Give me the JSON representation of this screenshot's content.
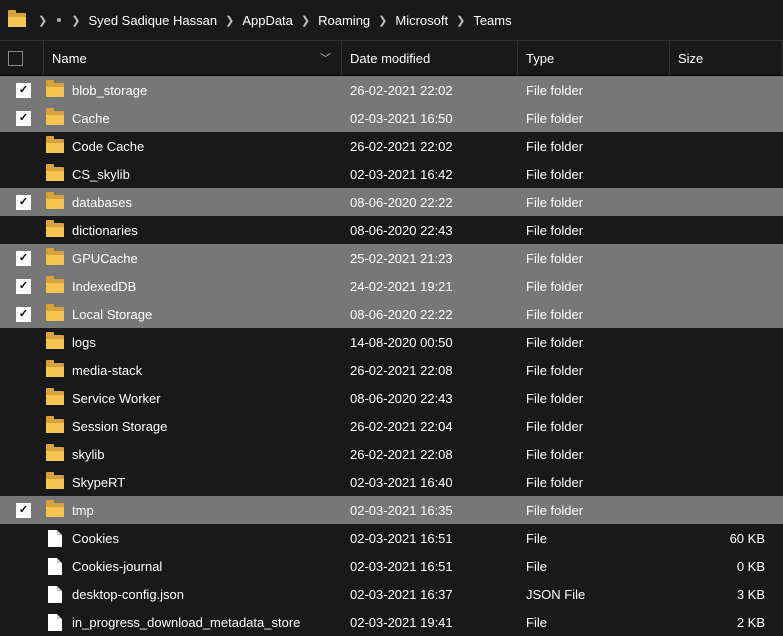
{
  "breadcrumb": {
    "items": [
      "Syed Sadique Hassan",
      "AppData",
      "Roaming",
      "Microsoft",
      "Teams"
    ]
  },
  "columns": {
    "name": "Name",
    "date": "Date modified",
    "type": "Type",
    "size": "Size"
  },
  "rows": [
    {
      "selected": true,
      "kind": "folder",
      "name": "blob_storage",
      "date": "26-02-2021 22:02",
      "type": "File folder",
      "size": ""
    },
    {
      "selected": true,
      "kind": "folder",
      "name": "Cache",
      "date": "02-03-2021 16:50",
      "type": "File folder",
      "size": ""
    },
    {
      "selected": false,
      "kind": "folder",
      "name": "Code Cache",
      "date": "26-02-2021 22:02",
      "type": "File folder",
      "size": ""
    },
    {
      "selected": false,
      "kind": "folder",
      "name": "CS_skylib",
      "date": "02-03-2021 16:42",
      "type": "File folder",
      "size": ""
    },
    {
      "selected": true,
      "kind": "folder",
      "name": "databases",
      "date": "08-06-2020 22:22",
      "type": "File folder",
      "size": ""
    },
    {
      "selected": false,
      "kind": "folder",
      "name": "dictionaries",
      "date": "08-06-2020 22:43",
      "type": "File folder",
      "size": ""
    },
    {
      "selected": true,
      "kind": "folder",
      "name": "GPUCache",
      "date": "25-02-2021 21:23",
      "type": "File folder",
      "size": ""
    },
    {
      "selected": true,
      "kind": "folder",
      "name": "IndexedDB",
      "date": "24-02-2021 19:21",
      "type": "File folder",
      "size": ""
    },
    {
      "selected": true,
      "kind": "folder",
      "name": "Local Storage",
      "date": "08-06-2020 22:22",
      "type": "File folder",
      "size": ""
    },
    {
      "selected": false,
      "kind": "folder",
      "name": "logs",
      "date": "14-08-2020 00:50",
      "type": "File folder",
      "size": ""
    },
    {
      "selected": false,
      "kind": "folder",
      "name": "media-stack",
      "date": "26-02-2021 22:08",
      "type": "File folder",
      "size": ""
    },
    {
      "selected": false,
      "kind": "folder",
      "name": "Service Worker",
      "date": "08-06-2020 22:43",
      "type": "File folder",
      "size": ""
    },
    {
      "selected": false,
      "kind": "folder",
      "name": "Session Storage",
      "date": "26-02-2021 22:04",
      "type": "File folder",
      "size": ""
    },
    {
      "selected": false,
      "kind": "folder",
      "name": "skylib",
      "date": "26-02-2021 22:08",
      "type": "File folder",
      "size": ""
    },
    {
      "selected": false,
      "kind": "folder",
      "name": "SkypeRT",
      "date": "02-03-2021 16:40",
      "type": "File folder",
      "size": ""
    },
    {
      "selected": true,
      "kind": "folder",
      "name": "tmp",
      "date": "02-03-2021 16:35",
      "type": "File folder",
      "size": ""
    },
    {
      "selected": false,
      "kind": "file",
      "name": "Cookies",
      "date": "02-03-2021 16:51",
      "type": "File",
      "size": "60 KB"
    },
    {
      "selected": false,
      "kind": "file",
      "name": "Cookies-journal",
      "date": "02-03-2021 16:51",
      "type": "File",
      "size": "0 KB"
    },
    {
      "selected": false,
      "kind": "file",
      "name": "desktop-config.json",
      "date": "02-03-2021 16:37",
      "type": "JSON File",
      "size": "3 KB"
    },
    {
      "selected": false,
      "kind": "file",
      "name": "in_progress_download_metadata_store",
      "date": "02-03-2021 19:41",
      "type": "File",
      "size": "2 KB"
    }
  ]
}
